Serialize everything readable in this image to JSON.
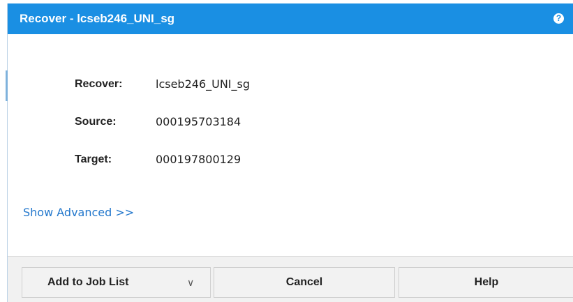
{
  "dialog": {
    "title": "Recover - lcseb246_UNI_sg",
    "help_icon": "?"
  },
  "fields": [
    {
      "label": "Recover:",
      "value": "lcseb246_UNI_sg"
    },
    {
      "label": "Source:",
      "value": "000195703184"
    },
    {
      "label": "Target:",
      "value": "000197800129"
    }
  ],
  "advanced_link": "Show Advanced >>",
  "buttons": {
    "add_to_job_list": "Add to Job List",
    "add_chevron": "∨",
    "cancel": "Cancel",
    "help": "Help"
  },
  "icons": {
    "help": "question-circle-icon",
    "dropdown": "chevron-down-icon"
  },
  "colors": {
    "title_bar": "#1a8fe3",
    "link": "#2277cc",
    "footer": "#f1f1f1"
  }
}
